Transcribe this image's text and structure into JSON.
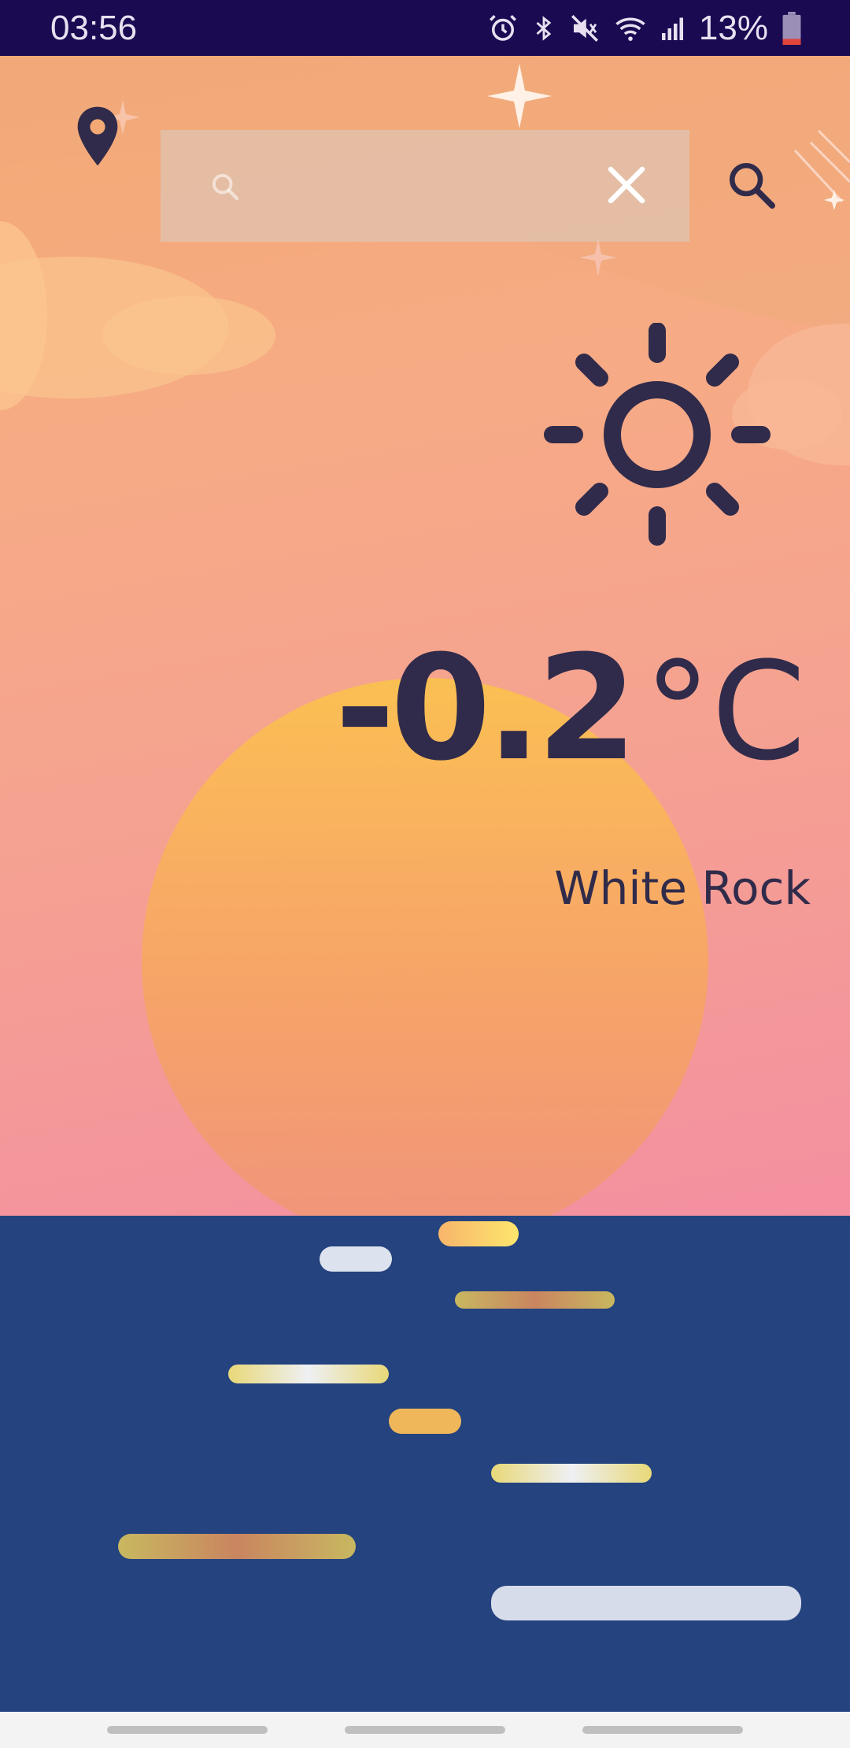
{
  "status_bar": {
    "time": "03:56",
    "battery_percent": "13%",
    "icons": [
      "alarm-icon",
      "bluetooth-icon",
      "mute-icon",
      "wifi-icon",
      "signal-icon",
      "battery-icon"
    ]
  },
  "search": {
    "query": "",
    "placeholder": "",
    "location_icon": "location-pin-icon",
    "clear_icon": "close-icon",
    "search_icon": "search-icon"
  },
  "weather": {
    "condition_icon": "sun-icon",
    "temperature_value": "-0.2",
    "temperature_unit": "°C",
    "city": "White Rock"
  },
  "colors": {
    "text_dark": "#302b4a",
    "status_bar": "#1a0a52",
    "sea": "#24437f",
    "sky_top": "#f4a975",
    "sky_bottom": "#f48fa0",
    "sun_disc": "#fbc24d"
  }
}
